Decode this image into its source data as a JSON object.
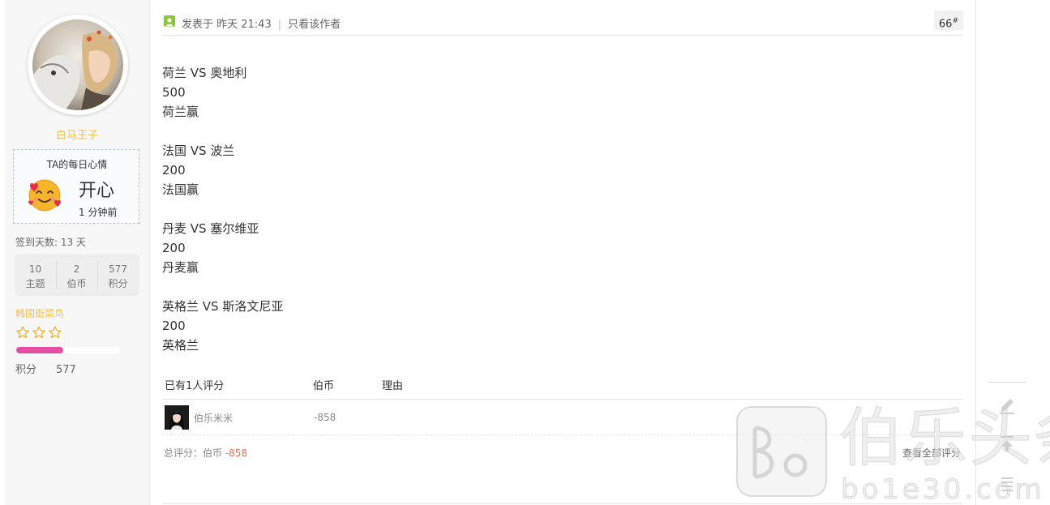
{
  "profile": {
    "username": "白马王子",
    "mood_title": "TA的每日心情",
    "mood_value": "开心",
    "mood_time": "1 分钟前",
    "signin_days": "签到天数: 13 天",
    "stats": [
      {
        "value": "10",
        "label": "主题"
      },
      {
        "value": "2",
        "label": "伯币"
      },
      {
        "value": "577",
        "label": "积分"
      }
    ],
    "rank_title": "韩国街菜鸟",
    "rank_stars": 3,
    "rank_progress": 0.45,
    "points_label": "积分",
    "points_value": "577",
    "colors": {
      "username": "#f0c24b",
      "rank_bar": "#e54da3"
    }
  },
  "post": {
    "posted_at": "发表于 昨天 21:43",
    "only_author": "只看该作者",
    "floor_number": "66",
    "floor_suffix": "#",
    "content_blocks": [
      [
        "荷兰 VS 奥地利",
        "500",
        "荷兰赢"
      ],
      [
        "法国 VS 波兰",
        "200",
        "法国赢"
      ],
      [
        "丹麦 VS 塞尔维亚",
        "200",
        "丹麦赢"
      ],
      [
        "英格兰 VS 斯洛文尼亚",
        "200",
        "英格兰"
      ]
    ]
  },
  "rating": {
    "header_count": "已有1人评分",
    "header_currency": "伯币",
    "header_reason": "理由",
    "rows": [
      {
        "user": "伯乐米米",
        "amount": "-858",
        "reason": ""
      }
    ],
    "total_label": "总评分：伯币",
    "total_value": "-858",
    "view_all": "查看全部评分"
  },
  "watermark": {
    "cn": "伯乐头条",
    "en": "bo1e30.com"
  },
  "icons": [
    "online-status-icon",
    "edit-icon",
    "back-to-top-icon",
    "list-icon"
  ]
}
